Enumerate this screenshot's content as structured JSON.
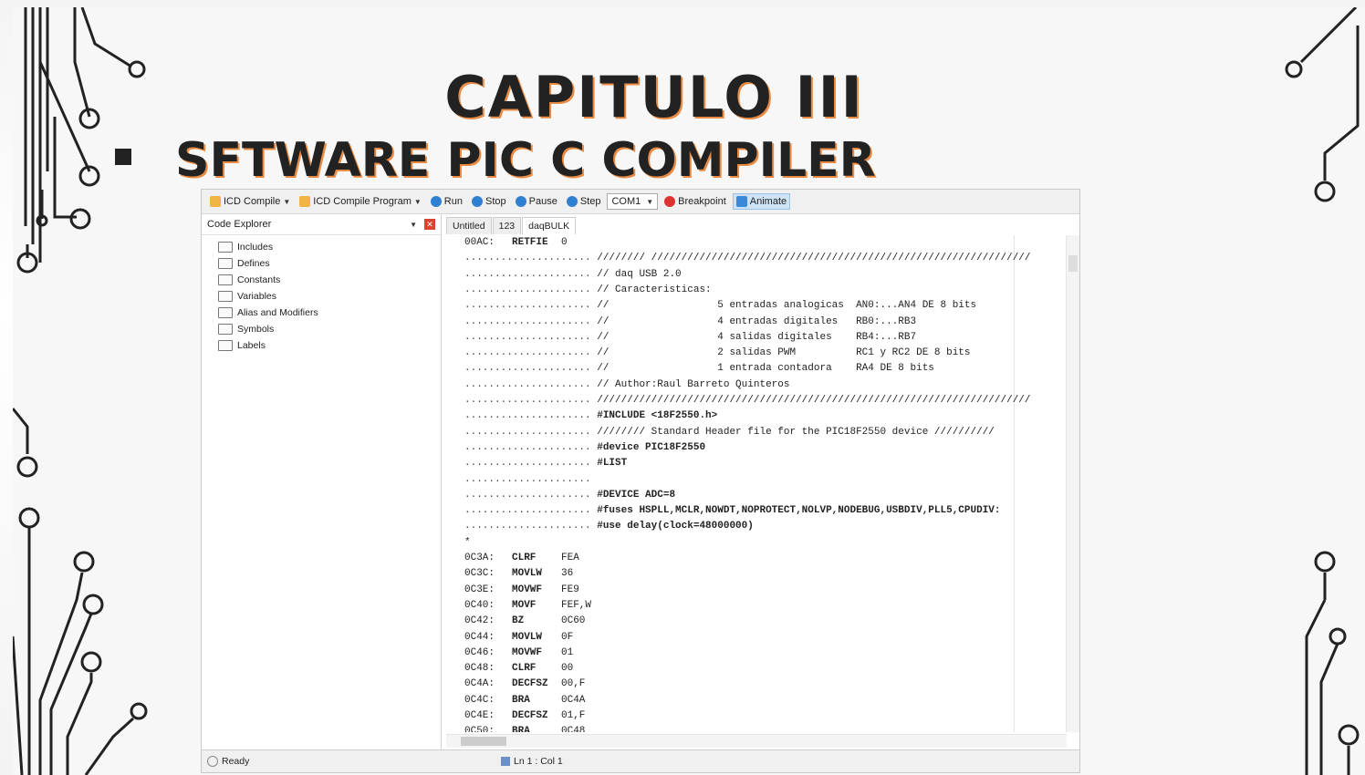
{
  "slide": {
    "title": "CAPITULO III",
    "subtitle": "SFTWARE PIC C COMPILER"
  },
  "toolbar": {
    "icd_compile": "ICD Compile",
    "icd_compile_program": "ICD Compile Program",
    "run": "Run",
    "stop": "Stop",
    "pause": "Pause",
    "step": "Step",
    "port": "COM1",
    "breakpoint": "Breakpoint",
    "animate": "Animate"
  },
  "explorer": {
    "title": "Code Explorer",
    "items": [
      "Includes",
      "Defines",
      "Constants",
      "Variables",
      "Alias and Modifiers",
      "Symbols",
      "Labels"
    ]
  },
  "tabs": [
    "Untitled",
    "123",
    "daqBULK"
  ],
  "code": [
    {
      "addr": "00AC:",
      "op": "RETFIE",
      "arg": "0"
    },
    {
      "dots": true,
      "text": "//////// ///////////////////////////////////////////////////////////////"
    },
    {
      "dots": true,
      "text": "// daq USB 2.0"
    },
    {
      "dots": true,
      "text": "// Caracteristicas:"
    },
    {
      "dots": true,
      "text": "//                  5 entradas analogicas  AN0:...AN4 DE 8 bits"
    },
    {
      "dots": true,
      "text": "//                  4 entradas digitales   RB0:...RB3"
    },
    {
      "dots": true,
      "text": "//                  4 salidas digitales    RB4:...RB7"
    },
    {
      "dots": true,
      "text": "//                  2 salidas PWM          RC1 y RC2 DE 8 bits"
    },
    {
      "dots": true,
      "text": "//                  1 entrada contadora    RA4 DE 8 bits"
    },
    {
      "dots": true,
      "text": "// Author:Raul Barreto Quinteros"
    },
    {
      "dots": true,
      "text": "////////////////////////////////////////////////////////////////////////"
    },
    {
      "dots": true,
      "text": "#INCLUDE <18F2550.h>"
    },
    {
      "dots": true,
      "text": "//////// Standard Header file for the PIC18F2550 device //////////"
    },
    {
      "dots": true,
      "text": "#device PIC18F2550"
    },
    {
      "dots": true,
      "text": "#LIST"
    },
    {
      "dots": true,
      "text": ""
    },
    {
      "dots": true,
      "text": "#DEVICE ADC=8"
    },
    {
      "dots": true,
      "text": "#fuses HSPLL,MCLR,NOWDT,NOPROTECT,NOLVP,NODEBUG,USBDIV,PLL5,CPUDIV:"
    },
    {
      "dots": true,
      "text": "#use delay(clock=48000000)"
    },
    {
      "text": "*"
    },
    {
      "addr": "0C3A:",
      "op": "CLRF",
      "arg": "FEA"
    },
    {
      "addr": "0C3C:",
      "op": "MOVLW",
      "arg": "36"
    },
    {
      "addr": "0C3E:",
      "op": "MOVWF",
      "arg": "FE9"
    },
    {
      "addr": "0C40:",
      "op": "MOVF",
      "arg": "FEF,W"
    },
    {
      "addr": "0C42:",
      "op": "BZ",
      "arg": "0C60"
    },
    {
      "addr": "0C44:",
      "op": "MOVLW",
      "arg": "0F"
    },
    {
      "addr": "0C46:",
      "op": "MOVWF",
      "arg": "01"
    },
    {
      "addr": "0C48:",
      "op": "CLRF",
      "arg": "00"
    },
    {
      "addr": "0C4A:",
      "op": "DECFSZ",
      "arg": "00,F"
    },
    {
      "addr": "0C4C:",
      "op": "BRA",
      "arg": "0C4A"
    },
    {
      "addr": "0C4E:",
      "op": "DECFSZ",
      "arg": "01,F"
    },
    {
      "addr": "0C50:",
      "op": "BRA",
      "arg": "0C48"
    }
  ],
  "status": {
    "ready": "Ready",
    "position": "Ln 1 : Col 1"
  }
}
